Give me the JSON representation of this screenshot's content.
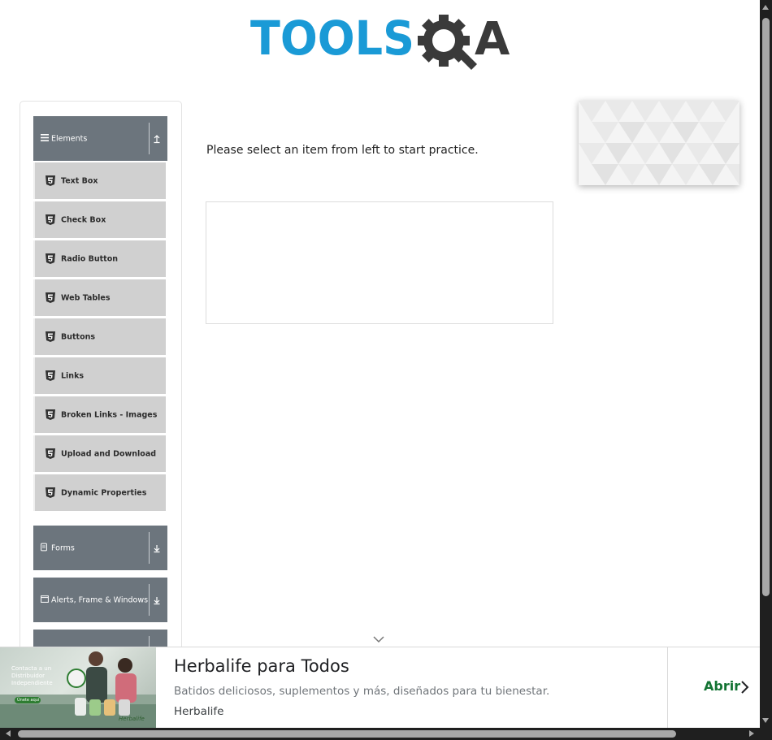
{
  "logo": {
    "part1": "TOOLS",
    "part2": "A"
  },
  "sidebar": {
    "groups": [
      {
        "label": "Elements",
        "icon": "hamburger-icon",
        "state": "expanded"
      },
      {
        "label": "Forms",
        "icon": "document-icon",
        "state": "collapsed"
      },
      {
        "label": "Alerts, Frame & Windows",
        "icon": "window-icon",
        "state": "collapsed"
      }
    ],
    "items": [
      {
        "label": "Text Box"
      },
      {
        "label": "Check Box"
      },
      {
        "label": "Radio Button"
      },
      {
        "label": "Web Tables"
      },
      {
        "label": "Buttons"
      },
      {
        "label": "Links"
      },
      {
        "label": "Broken Links - Images"
      },
      {
        "label": "Upload and Download"
      },
      {
        "label": "Dynamic Properties"
      }
    ]
  },
  "main": {
    "prompt": "Please select an item from left to start practice."
  },
  "ad": {
    "title": "Herbalife para Todos",
    "description": "Batidos deliciosos, suplementos y más, diseñados para tu bienestar.",
    "brand": "Herbalife",
    "cta": "Abrir",
    "image_text": {
      "line1": "Contacta a un",
      "line2": "Distribuidor",
      "line3": "Independiente",
      "button": "Únete aquí",
      "logo": "Herbalife"
    }
  },
  "colors": {
    "logo_blue": "#1a9ad6",
    "logo_dark": "#3a3a3a",
    "group_header_bg": "#6c757d",
    "menu_item_bg": "#d0d0d0",
    "cta_green": "#137333"
  }
}
